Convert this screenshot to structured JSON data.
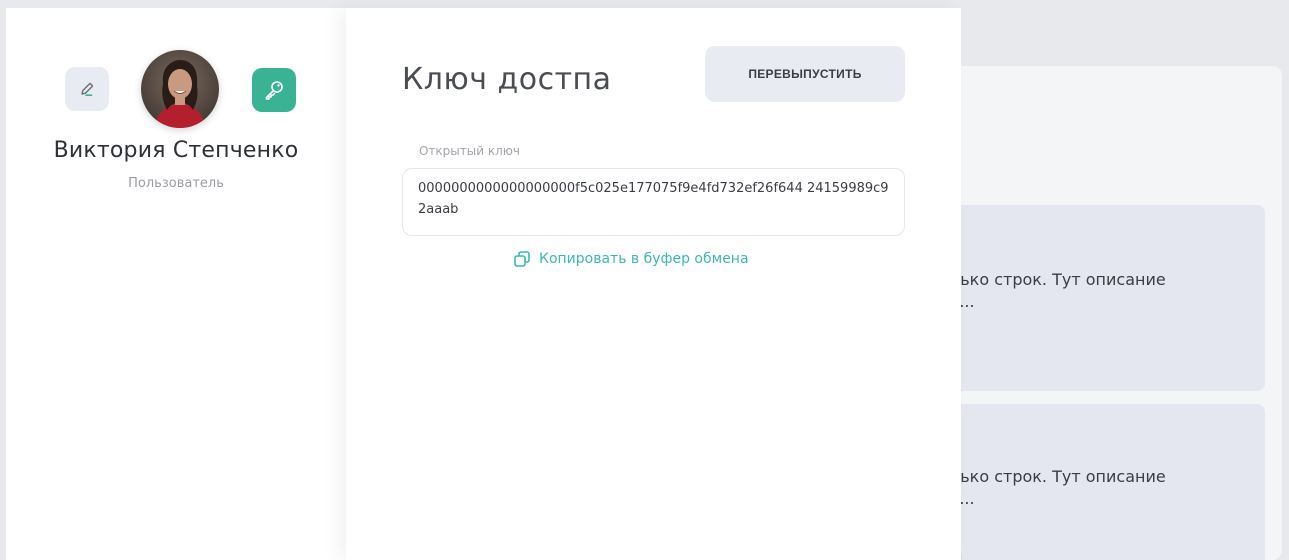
{
  "profile": {
    "name": "Виктория Степченко",
    "role": "Пользователь"
  },
  "drawer": {
    "title": "Ключ достпа",
    "reissue_label": "ПЕРЕВЫПУСТИТЬ",
    "public_key_label": "Открытый ключ",
    "public_key_value": "0000000000000000000f5c025e177075f9e4fd732ef26f644 24159989c92aaab",
    "copy_label": "Копировать в буфер обмена"
  },
  "background_list": {
    "items": [
      {
        "text": "лько строк. Тут описание\nт..."
      },
      {
        "text": "лько строк. Тут описание\nт..."
      }
    ]
  },
  "colors": {
    "accent_green": "#3ab394",
    "link_teal": "#3cb8b2",
    "button_bg": "#e9ebf3"
  },
  "icons": {
    "edit": "pencil-icon",
    "key": "key-icon",
    "copy": "copy-icon"
  }
}
